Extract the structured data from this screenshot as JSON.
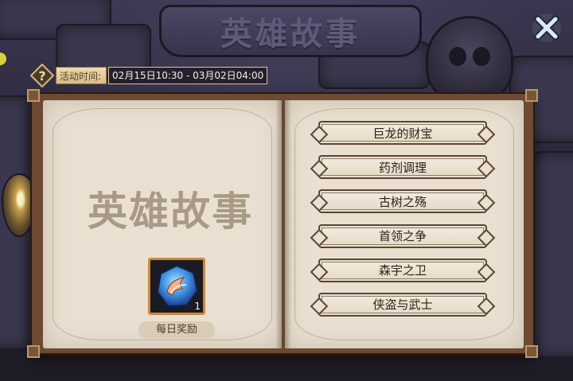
{
  "background": {
    "banner_title": "英雄故事"
  },
  "header": {
    "close_icon": "close-x-icon",
    "help_icon": "question-mark-icon",
    "event_time_label": "活动时间:",
    "event_time_value": "02月15日10:30 - 03月02日04:00"
  },
  "book": {
    "title": "英雄故事",
    "daily_reward": {
      "label": "每日奖励",
      "count": "1",
      "icon": "blue-wing-gem-icon"
    },
    "stories": [
      {
        "label": "巨龙的财宝"
      },
      {
        "label": "药剂调理"
      },
      {
        "label": "古树之殇"
      },
      {
        "label": "首领之争"
      },
      {
        "label": "森宇之卫"
      },
      {
        "label": "侠盗与武士"
      }
    ]
  },
  "colors": {
    "page": "#e9e0d2",
    "cover": "#6e4a32",
    "accent_gold": "#c9893a",
    "gem_blue": "#3f8fe0"
  }
}
